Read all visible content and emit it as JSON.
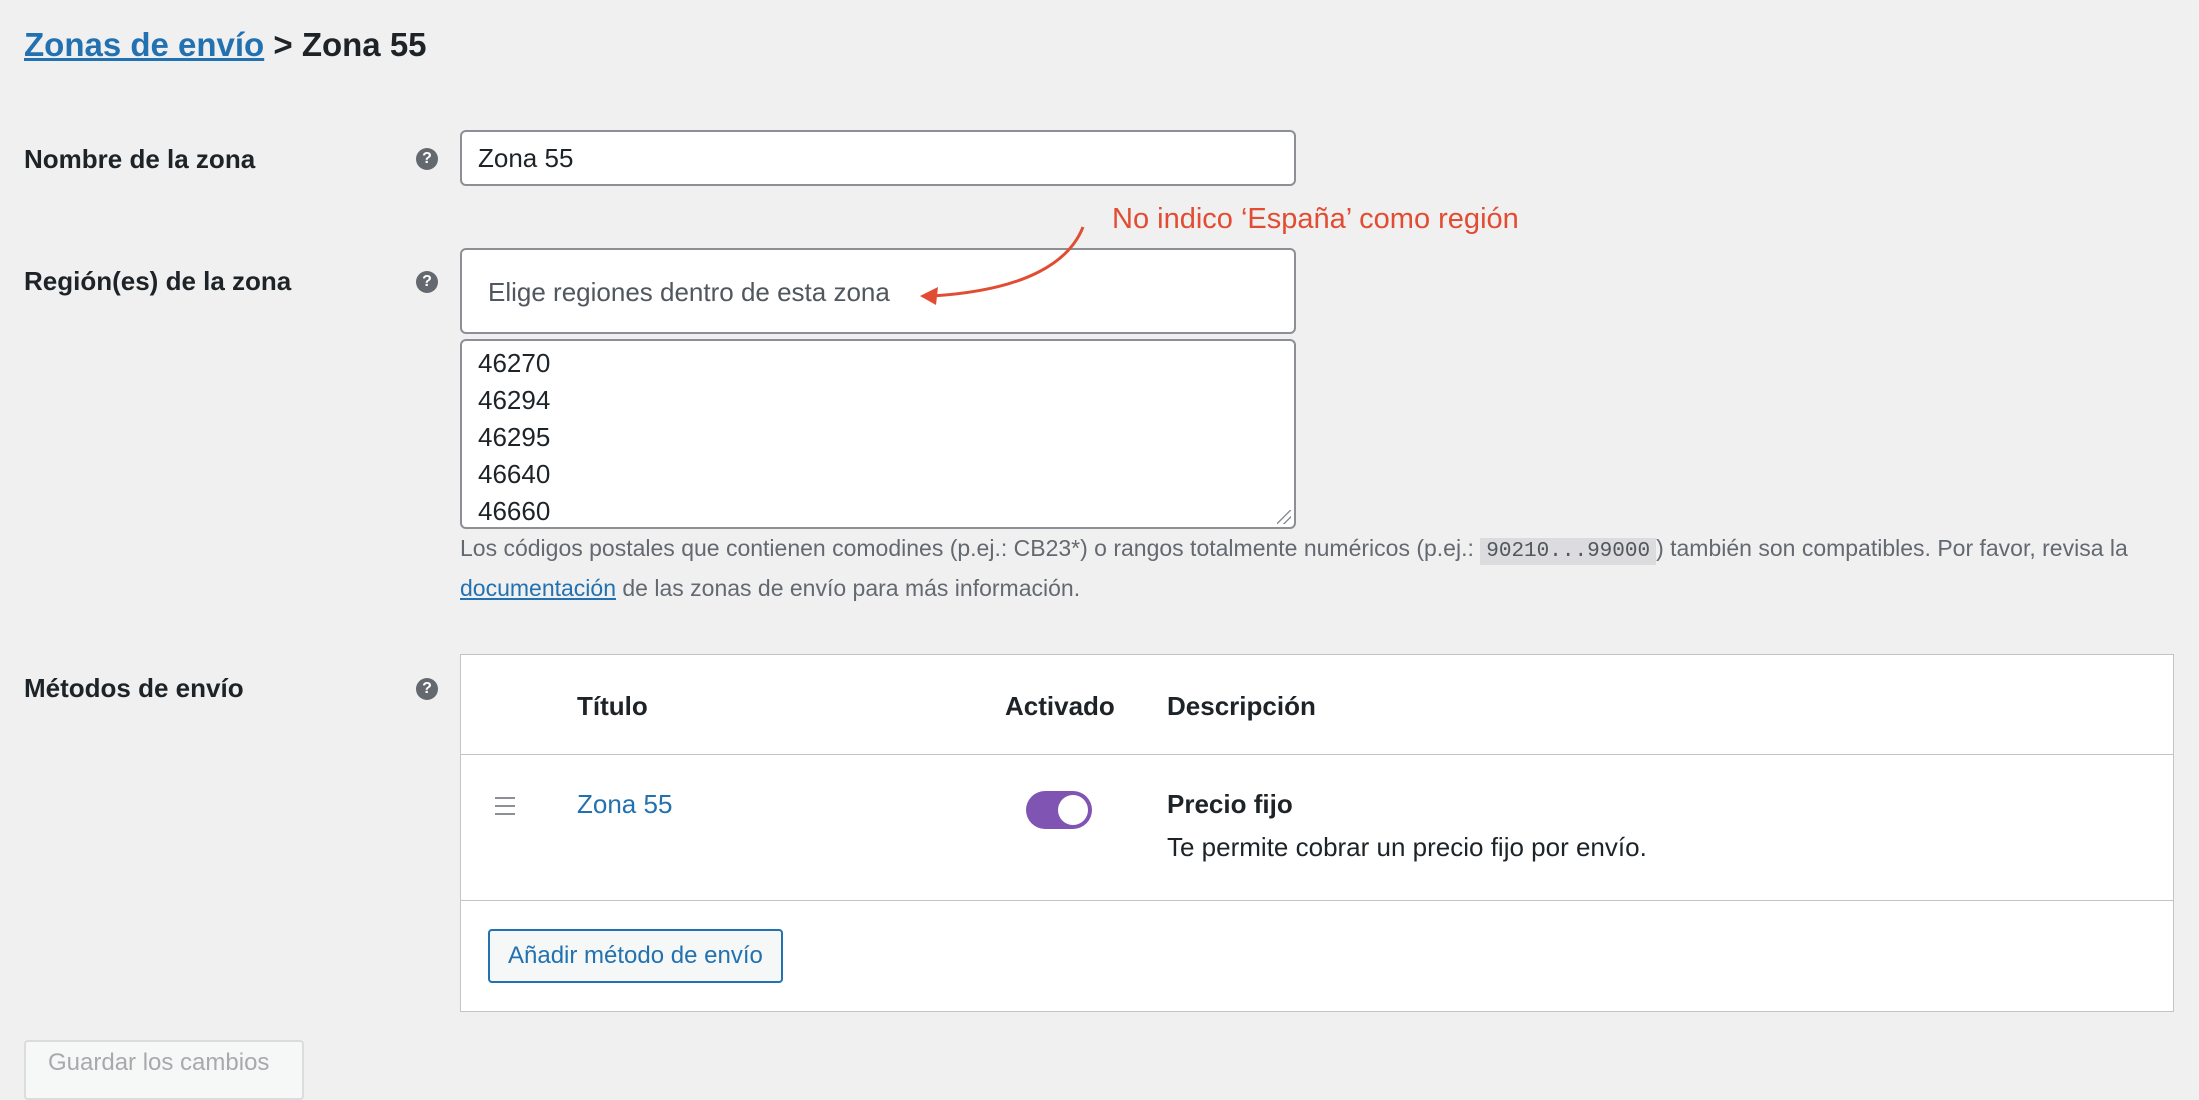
{
  "breadcrumb": {
    "parent_link": "Zonas de envío",
    "separator": " > ",
    "current": "Zona 55"
  },
  "zone_name": {
    "label": "Nombre de la zona",
    "value": "Zona 55",
    "help_icon": "question-circle-icon"
  },
  "zone_regions": {
    "label": "Región(es) de la zona",
    "placeholder": "Elige regiones dentro de esta zona",
    "help_icon": "question-circle-icon",
    "postcodes": [
      "46270",
      "46294",
      "46295",
      "46640",
      "46660"
    ],
    "help_text_before": "Los códigos postales que contienen comodines (p.ej.: CB23*) o rangos totalmente numéricos (p.ej.: ",
    "help_text_code": "90210...99000",
    "help_text_middle": ") también son compatibles. Por favor, revisa la ",
    "help_text_link": "documentación",
    "help_text_after": " de las zonas de envío para más información."
  },
  "annotation": {
    "text": "No indico ‘España’ como región",
    "color": "#e24c32"
  },
  "shipping_methods": {
    "label": "Métodos de envío",
    "help_icon": "question-circle-icon",
    "columns": {
      "title": "Título",
      "enabled": "Activado",
      "description": "Descripción"
    },
    "rows": [
      {
        "title": "Zona 55",
        "enabled": true,
        "method_name": "Precio fijo",
        "method_description": "Te permite cobrar un precio fijo por envío."
      }
    ],
    "add_button": "Añadir método de envío"
  },
  "save_button": "Guardar los cambios",
  "colors": {
    "link": "#2271b1",
    "toggle_on": "#7f54b3",
    "background": "#f0f0f1"
  }
}
